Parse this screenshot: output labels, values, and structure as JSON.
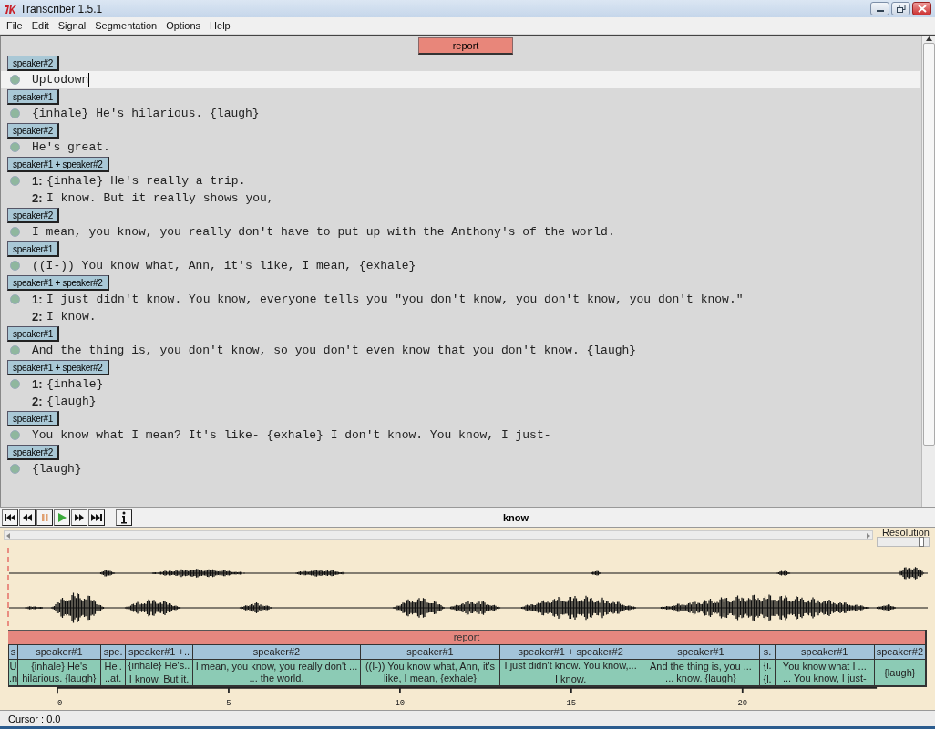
{
  "window": {
    "title": "Transcriber 1.5.1"
  },
  "menu": [
    "File",
    "Edit",
    "Signal",
    "Segmentation",
    "Options",
    "Help"
  ],
  "editor": {
    "section": "report",
    "turns": [
      {
        "speaker": "speaker#2",
        "lines": [
          {
            "text": "Uptodown",
            "current": true
          }
        ]
      },
      {
        "speaker": "speaker#1",
        "lines": [
          {
            "text": "{inhale} He's hilarious. {laugh}",
            "current": false
          }
        ]
      },
      {
        "speaker": "speaker#2",
        "lines": [
          {
            "text": "He's great.",
            "current": false
          }
        ]
      },
      {
        "speaker": "speaker#1 + speaker#2",
        "lines": [
          {
            "index": "1:",
            "text": "{inhale} He's really a trip.",
            "current": false
          },
          {
            "index": "2:",
            "text": "I know. But it really shows you,",
            "current": false
          }
        ]
      },
      {
        "speaker": "speaker#2",
        "lines": [
          {
            "text": "I mean, you know, you really don't have to put up with the Anthony's of the world.",
            "current": false
          }
        ]
      },
      {
        "speaker": "speaker#1",
        "lines": [
          {
            "text": "((I-)) You know what, Ann, it's like, I mean, {exhale}",
            "current": false
          }
        ]
      },
      {
        "speaker": "speaker#1 + speaker#2",
        "lines": [
          {
            "index": "1:",
            "text": "I just didn't know. You know, everyone tells you \"you don't know, you don't know, you don't know.\"",
            "current": false
          },
          {
            "index": "2:",
            "text": "I know.",
            "current": false
          }
        ]
      },
      {
        "speaker": "speaker#1",
        "lines": [
          {
            "text": "And the thing is, you don't know, so you don't even know that you don't know. {laugh}",
            "current": false
          }
        ]
      },
      {
        "speaker": "speaker#1 + speaker#2",
        "lines": [
          {
            "index": "1:",
            "text": "{inhale}",
            "current": false
          },
          {
            "index": "2:",
            "text": "{laugh}",
            "current": false
          }
        ]
      },
      {
        "speaker": "speaker#1",
        "lines": [
          {
            "text": "You know what I mean? It's like- {exhale} I don't know. You know, I just-",
            "current": false
          }
        ]
      },
      {
        "speaker": "speaker#2",
        "lines": [
          {
            "text": "{laugh}",
            "current": false
          }
        ]
      }
    ]
  },
  "toolbar": {
    "word": "know"
  },
  "signal": {
    "resolution_label": "Resolution",
    "resolution": {
      "level": 0.9
    }
  },
  "timeline": {
    "section": "report",
    "segments": [
      {
        "kind": "single",
        "speaker": "s",
        "lines": [
          "U",
          ".n"
        ]
      },
      {
        "kind": "single",
        "speaker": "speaker#1",
        "lines": [
          "{inhale} He's",
          "hilarious. {laugh}"
        ]
      },
      {
        "kind": "single",
        "speaker": "spe.",
        "lines": [
          "He'.",
          "..at."
        ]
      },
      {
        "kind": "overlap",
        "speaker": "speaker#1 +..",
        "lines": [
          "{inhale} He's..",
          "I know. But it."
        ]
      },
      {
        "kind": "single",
        "speaker": "speaker#2",
        "lines": [
          "I mean, you know, you really don't ...",
          "... the world."
        ]
      },
      {
        "kind": "single",
        "speaker": "speaker#1",
        "lines": [
          "((I-)) You know what, Ann, it's",
          "like, I mean, {exhale}"
        ]
      },
      {
        "kind": "overlap",
        "speaker": "speaker#1 + speaker#2",
        "lines": [
          "I just didn't know. You know,...",
          "I know."
        ]
      },
      {
        "kind": "single",
        "speaker": "speaker#1",
        "lines": [
          "And the thing is, you ...",
          "... know. {laugh}"
        ]
      },
      {
        "kind": "overlap",
        "speaker": "s.",
        "lines": [
          "{i.",
          "{l."
        ]
      },
      {
        "kind": "single",
        "speaker": "speaker#1",
        "lines": [
          "You know what I ...",
          "... You know, I just-"
        ]
      },
      {
        "kind": "single",
        "speaker": "speaker#2",
        "lines": [
          "{laugh}"
        ]
      }
    ],
    "ticks": [
      "0",
      "5",
      "10",
      "15",
      "20"
    ]
  },
  "status_bar": "Cursor : 0.0"
}
